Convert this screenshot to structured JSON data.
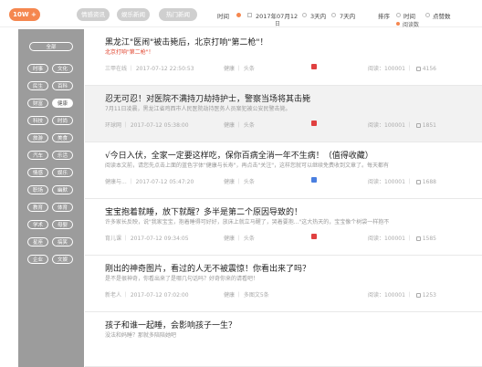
{
  "topbar": {
    "hot_pill": "10W +",
    "pills": [
      "情感资讯",
      "娱乐新闻",
      "热门新闻"
    ],
    "time_label": "时间",
    "date_value": "2017年07月12",
    "date_suffix": "日",
    "range_3": "3天内",
    "range_7": "7天内",
    "sort_label": "排序",
    "sort_time": "时间",
    "sort_reads": "点赞数",
    "sort_sub": "阅读数"
  },
  "sidebar": {
    "all_label": "全部",
    "categories": [
      [
        "时事",
        "文化"
      ],
      [
        "民生",
        "百科"
      ],
      [
        "财富",
        "健康"
      ],
      [
        "科技",
        "时尚"
      ],
      [
        "旅游",
        "美食"
      ],
      [
        "汽车",
        "乐活"
      ],
      [
        "情感",
        "娱乐"
      ],
      [
        "职场",
        "幽默"
      ],
      [
        "教育",
        "体育"
      ],
      [
        "学术",
        "母婴"
      ],
      [
        "星座",
        "搞笑"
      ],
      [
        "企业",
        "文娱"
      ]
    ],
    "active": "健康"
  },
  "articles": [
    {
      "title": "黑龙江\"医闹\"被击毙后，北京打响\"第二枪\"！",
      "summary": "北京打响\"第二枪\"！",
      "source": "三甲在线",
      "date": "2017-07-12 22:50:53",
      "category": "健康 ｜ 头条",
      "reads": "阅读：100001",
      "likes": "4156",
      "badge": "red"
    },
    {
      "title": "忍无可忍！对医院不满持刀劫持护士，警察当场将其击毙",
      "summary": "7月11日凌晨，黑龙江省鸡西市人民医院劫持医务人员案犯被公安民警击毙。",
      "source": "环球网",
      "date": "2017-07-12 05:38:00",
      "category": "健康 ｜ 头条",
      "reads": "阅读：100001",
      "likes": "1851",
      "badge": "red"
    },
    {
      "title": "√今日入伏，全家一定要这样吃，保你百病全消一年不生病！（值得收藏）",
      "summary": "阅读本文前，请您先点击上面的蓝色字体\"健康与长寿\"，再点击\"关注\"，这样您就可以继续免费收到文章了。每天都有",
      "source": "健康与...",
      "date": "2017-07-12 05:47:20",
      "category": "健康 ｜ 头条",
      "reads": "阅读：100001",
      "likes": "1688",
      "badge": "blue"
    },
    {
      "title": "宝宝抱着就睡，放下就醒？多半是第二个原因导致的！",
      "summary": "许多家长反映，说\"我家宝宝，抱着睡得可好好，放床上就立马醒了，哭着要抱...\"这大热天的，宝宝像个树袋一样抱不",
      "source": "育儿课",
      "date": "2017-07-12 09:34:05",
      "category": "健康 ｜ 头条",
      "reads": "阅读：100001",
      "likes": "1585",
      "badge": "red"
    },
    {
      "title": "刚出的神奇图片，看过的人无不被震惊！你看出来了吗？",
      "summary": "是不是很神奇，你看出来了是哪几句话吗？好奇你来的请看吧！",
      "source": "新老人",
      "date": "2017-07-12 07:02:00",
      "category": "健康 ｜ 多图文5条",
      "reads": "阅读：100001",
      "likes": "1253",
      "badge": "none"
    },
    {
      "title": "孩子和谁一起睡，会影响孩子一生？",
      "summary": "没法和妈睡？那就多陪陪她吧",
      "source": "",
      "date": "",
      "category": "",
      "reads": "",
      "likes": "",
      "badge": "none"
    }
  ]
}
